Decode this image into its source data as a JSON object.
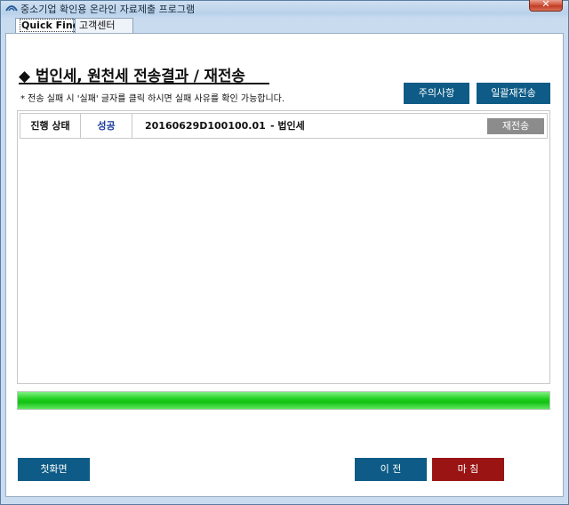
{
  "window": {
    "title": "중소기업 확인용 온라인 자료제출 프로그램",
    "close_label": "✕"
  },
  "tabs": [
    {
      "label": "Quick Find",
      "active": true
    },
    {
      "label": "고객센터",
      "active": false
    }
  ],
  "page": {
    "title": "법인세, 원천세 전송결과 / 재전송",
    "title_marker": "◆",
    "notice": "* 전송 실패 시 '실패' 글자를 클릭 하시면 실패 사유를 확인 가능합니다.",
    "notice_button": "주의사항",
    "resend_all_button": "일괄재전송"
  },
  "results": [
    {
      "label": "진행 상태",
      "status": "성공",
      "submission_id": "20160629D100100.01",
      "tax_type": "- 법인세",
      "resend_label": "재전송"
    }
  ],
  "progress": {
    "value_percent": 100,
    "color": "#22d022"
  },
  "footer": {
    "home_button": "첫화면",
    "prev_button": "이 전",
    "finish_button": "마 침"
  },
  "colors": {
    "accent_blue": "#0d5b86",
    "accent_red": "#9a1414",
    "status_success": "#1a3a9a"
  }
}
